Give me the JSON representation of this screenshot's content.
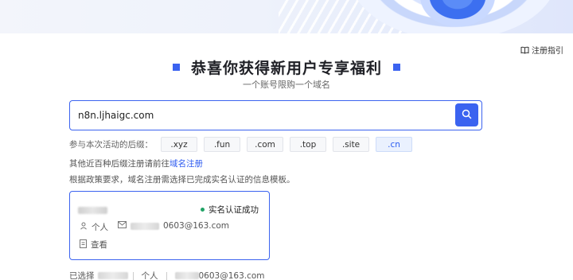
{
  "banner": {
    "text": ""
  },
  "guide": {
    "label": "注册指引",
    "icon": "book-icon"
  },
  "hero": {
    "title": "恭喜你获得新用户专享福利",
    "subtitle": "一个账号限购一个域名"
  },
  "search": {
    "value": "n8n.ljhaigc.com",
    "button_icon": "search-icon"
  },
  "suffixes": {
    "label": "参与本次活动的后缀：",
    "items": [
      {
        "label": ".xyz",
        "active": false
      },
      {
        "label": ".fun",
        "active": false
      },
      {
        "label": ".com",
        "active": false
      },
      {
        "label": ".top",
        "active": false
      },
      {
        "label": ".site",
        "active": false
      },
      {
        "label": ".cn",
        "active": true
      }
    ]
  },
  "other": {
    "prefix": "其他近百种后缀注册请前往",
    "link": "域名注册"
  },
  "policy": {
    "text": "根据政策要求，域名注册需选择已完成实名认证的信息模板。"
  },
  "template_card": {
    "status": "实名认证成功",
    "type": "个人",
    "email_suffix": "0603@163.com",
    "view_label": "查看"
  },
  "selected": {
    "prefix": "已选择",
    "type": "个人",
    "email_suffix": "0603@163.com"
  },
  "colors": {
    "accent": "#3b63f0",
    "success": "#21a366"
  }
}
